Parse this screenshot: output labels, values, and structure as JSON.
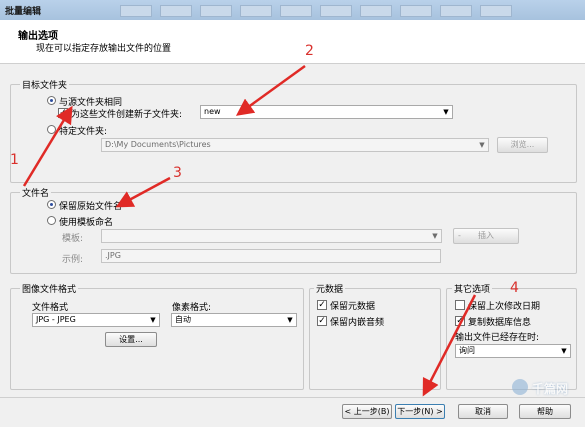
{
  "window": {
    "title": "批量编辑"
  },
  "header": {
    "title": "输出选项",
    "subtitle": "现在可以指定存放输出文件的位置"
  },
  "target_folder": {
    "group_label": "目标文件夹",
    "same_as_source_label": "与源文件夹相同",
    "create_subfolder_label": "为这些文件创建新子文件夹:",
    "subfolder_value": "new",
    "specific_folder_label": "特定文件夹:",
    "path_value": "D:\\My Documents\\Pictures",
    "browse_label": "浏览..."
  },
  "filename": {
    "group_label": "文件名",
    "keep_original_label": "保留原始文件名",
    "use_template_label": "使用模板命名",
    "template_label": "模板:",
    "insert_label": "插入",
    "example_label": "示例:",
    "example_value": ".JPG"
  },
  "image_format": {
    "group_label": "图像文件格式",
    "file_format_label": "文件格式",
    "file_format_value": "JPG - JPEG",
    "pixel_format_label": "像素格式:",
    "pixel_format_value": "自动",
    "settings_label": "设置..."
  },
  "metadata": {
    "group_label": "元数据",
    "keep_metadata_label": "保留元数据",
    "keep_audio_label": "保留内嵌音频"
  },
  "other_options": {
    "group_label": "其它选项",
    "keep_last_modified_label": "保留上次修改日期",
    "copy_db_info_label": "复制数据库信息",
    "if_exists_label": "输出文件已经存在时:",
    "if_exists_value": "询问"
  },
  "footer": {
    "back_label": "< 上一步(B)",
    "next_label": "下一步(N) >",
    "cancel_label": "取消",
    "help_label": "帮助"
  },
  "annotations": {
    "n1": "1",
    "n2": "2",
    "n3": "3",
    "n4": "4"
  },
  "watermark": "千篇网",
  "colors": {
    "arrow": "#e02a26",
    "titlebar": "#b9d1ea"
  }
}
